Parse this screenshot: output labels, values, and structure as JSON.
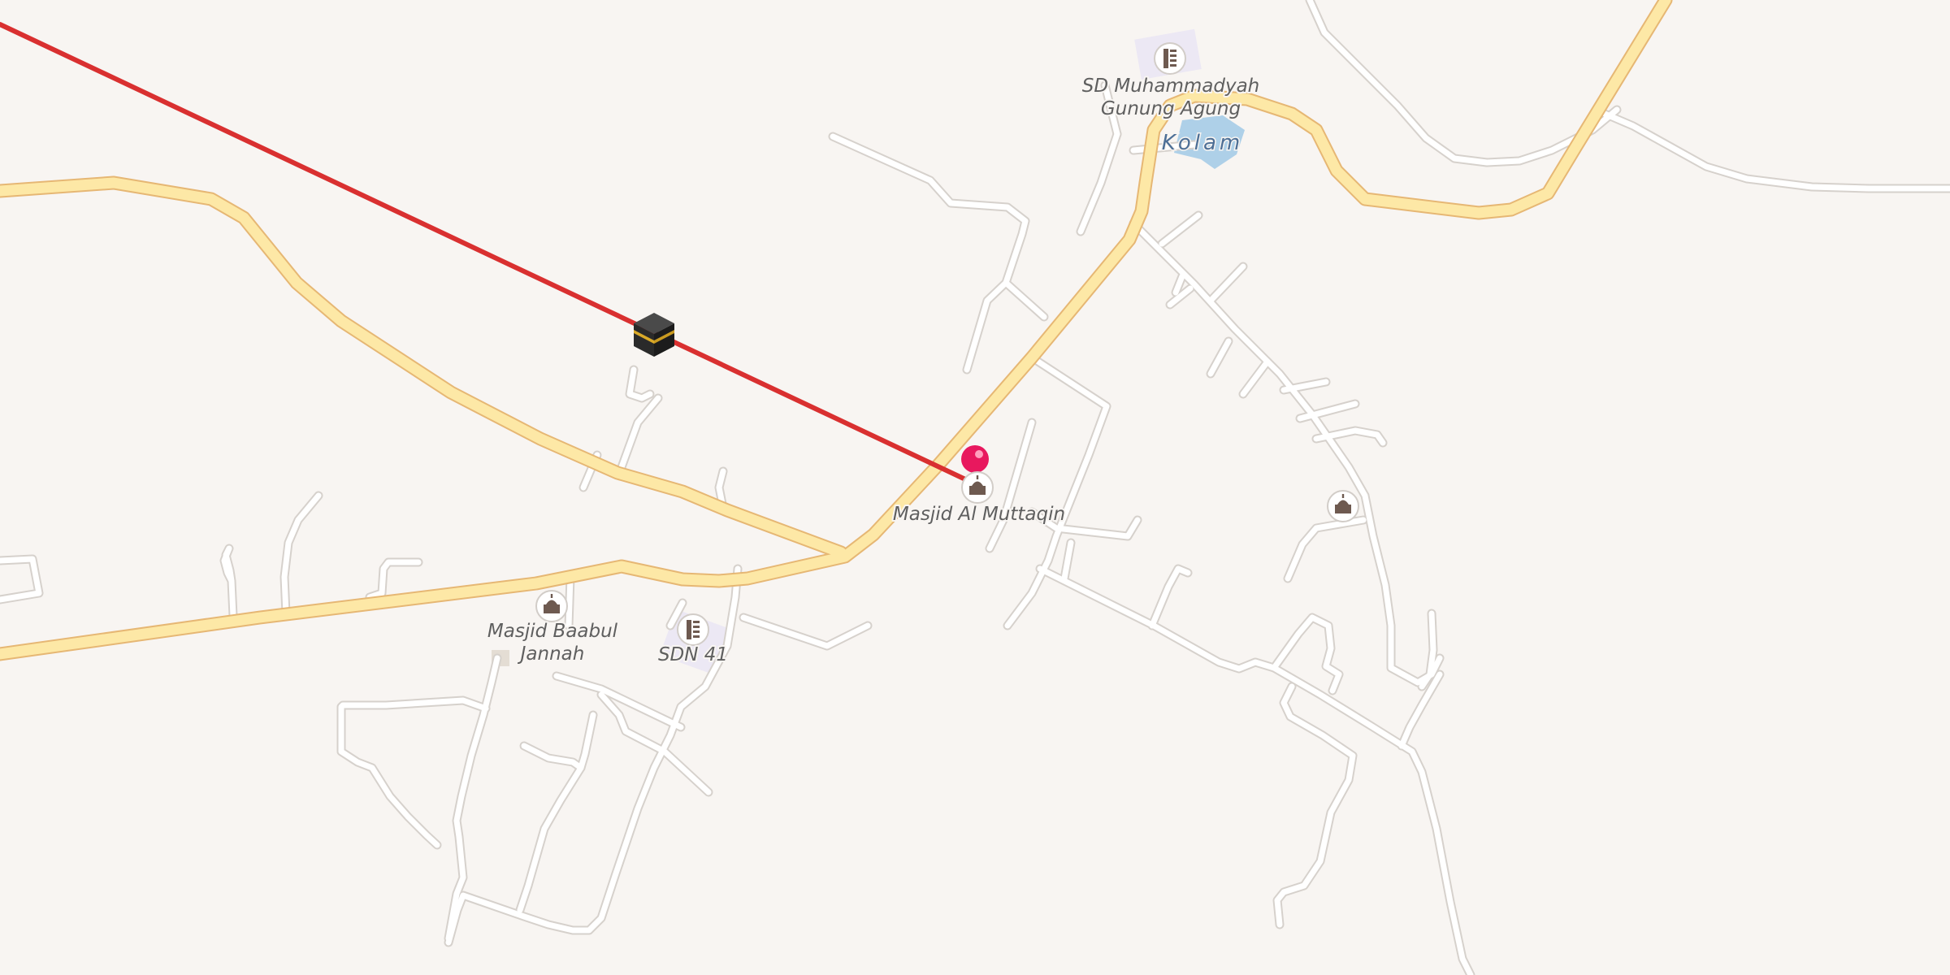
{
  "map": {
    "colors": {
      "background": "#f8f5f2",
      "major_road": "#fde8a6",
      "major_road_casing": "#e6b774",
      "minor_road": "#ffffff",
      "qibla_line": "#d93030",
      "water": "#aed0e8",
      "marker": "#e8185e"
    },
    "labels": {
      "school_north_line1": "SD Muhammadyah",
      "school_north_line2": "Gunung Agung",
      "pond": "Kolam",
      "mosque_al_muttaqin": "Masjid Al Muttaqin",
      "mosque_baabul_line1": "Masjid Baabul",
      "mosque_baabul_line2": "Jannah",
      "school_sdn41": "SDN 41"
    },
    "icons": {
      "kaaba": "kaaba-icon",
      "mosque": "mosque-icon",
      "school": "school-icon",
      "location_pin": "location-pin-icon"
    }
  }
}
